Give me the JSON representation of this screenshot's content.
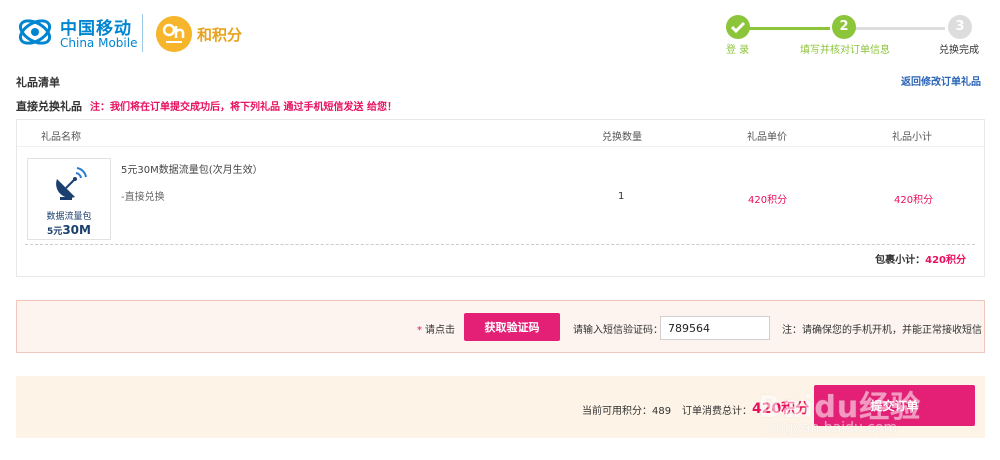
{
  "header": {
    "brand_cn": "中国移动",
    "brand_en": "China Mobile",
    "points_brand": "和积分",
    "logo_color": "#0085d0",
    "points_logo_color": "#f7b52c",
    "logo_icon": "china-mobile-logo-icon",
    "points_logo_icon": "and-logo-icon"
  },
  "steps": [
    {
      "marker": "",
      "label": "登 录",
      "state": "done",
      "icon": "check-icon"
    },
    {
      "marker": "2",
      "label": "填写并核对订单信息",
      "state": "current"
    },
    {
      "marker": "3",
      "label": "兑换完成",
      "state": "pending"
    }
  ],
  "gift_list": {
    "title": "礼品清单",
    "return_link": "返回修改订单礼品",
    "direct_title": "直接兑换礼品",
    "direct_note": "注：我们将在订单提交成功后，将下列礼品 通过手机短信发送 给您！",
    "columns": [
      "礼品名称",
      "兑换数量",
      "礼品单价",
      "礼品小计"
    ],
    "items": [
      {
        "thumb_label": "数据流量包",
        "thumb_price_prefix": "5元",
        "thumb_price_main": "30M",
        "thumb_icon": "satellite-dish-icon",
        "name": "5元30M数据流量包(次月生效）",
        "method": "-直接兑换",
        "qty": "1",
        "unit_price": "420积分",
        "subtotal": "420积分"
      }
    ],
    "package_subtotal_label": "包裹小计：",
    "package_subtotal_value": "420积分"
  },
  "verify": {
    "prompt_star": "*",
    "prompt": "请点击",
    "get_code_button": "获取验证码",
    "sms_label": "请输入短信验证码：",
    "sms_value": "789564",
    "note": "注：请确保您的手机开机，并能正常接收短信"
  },
  "summary": {
    "available_points": "当前可用积分：489",
    "order_total_label": "订单消费总计：",
    "order_total_value": "420积分",
    "submit_button": "提交订单"
  },
  "watermark": {
    "main": "Baidu经验",
    "sub": "jingyan.baidu.com"
  },
  "colors": {
    "accent": "#e31f76",
    "price": "#e8105f",
    "step_done": "#8cc43a",
    "step_pending": "#dddddd",
    "link": "#2a64b5"
  }
}
